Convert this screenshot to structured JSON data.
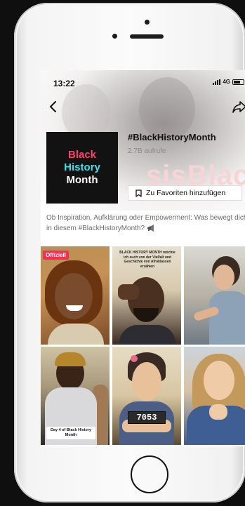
{
  "status_bar": {
    "time": "13:22",
    "network": "4G"
  },
  "hashtag": {
    "cover_lines": [
      "Black",
      "History",
      "Month"
    ],
    "title": "#BlackHistoryMonth",
    "views": "2.7B aufrufe",
    "favorite_label": "Zu Favoriten hinzufügen",
    "background_word": "sisBlack",
    "description": "Ob Inspiration, Aufklärung oder Empowerment: Was bewegt dich in diesem #BlackHistoryMonth?"
  },
  "videos": [
    {
      "badge": "Offiziell"
    },
    {
      "caption": "BLACK HISTORY MONTH möchte ich euch von der Vielfalt und Geschichte von Afroklassen erzählen"
    },
    {
      "caption": ""
    },
    {
      "label": "Day 4 of Black History Month"
    },
    {
      "plate": "7053"
    },
    {
      "caption": ""
    }
  ],
  "colors": {
    "cover_black": "#ff3f6c",
    "cover_history": "#3ee2f0",
    "cover_month": "#ffffff",
    "badge": "#fe2c55"
  },
  "icons": [
    "back-arrow-icon",
    "share-icon",
    "bookmark-icon",
    "megaphone-icon",
    "signal-icon",
    "battery-icon"
  ]
}
